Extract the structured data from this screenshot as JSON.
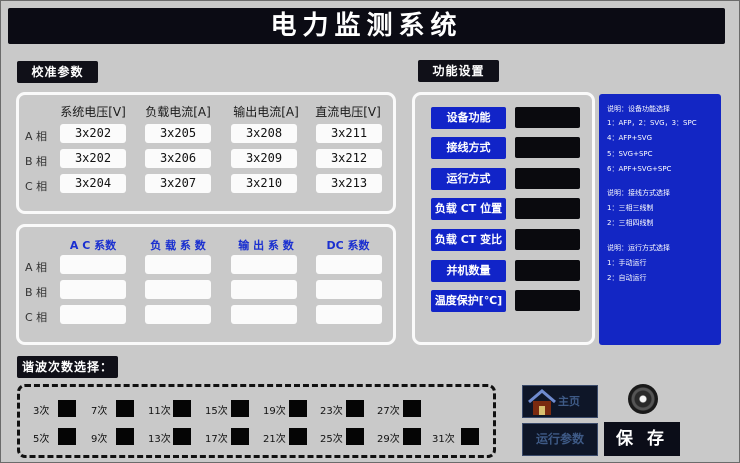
{
  "title": "电力监测系统",
  "sections": {
    "calibration": "校准参数",
    "function": "功能设置",
    "harmonic": "谐波次数选择："
  },
  "calibration_table": {
    "headers": [
      "系统电压[V]",
      "负载电流[A]",
      "输出电流[A]",
      "直流电压[V]"
    ],
    "row_labels": [
      "A 相",
      "B 相",
      "C 相"
    ],
    "rows": [
      [
        "3x202",
        "3x205",
        "3x208",
        "3x211"
      ],
      [
        "3x202",
        "3x206",
        "3x209",
        "3x212"
      ],
      [
        "3x204",
        "3x207",
        "3x210",
        "3x213"
      ]
    ]
  },
  "coefficient_table": {
    "headers": [
      "A C 系数",
      "负 载 系 数",
      "输 出 系 数",
      "DC 系数"
    ],
    "row_labels": [
      "A 相",
      "B 相",
      "C 相"
    ]
  },
  "function_buttons": [
    "设备功能",
    "接线方式",
    "运行方式",
    "负载 CT 位置",
    "负载 CT 变比",
    "并机数量",
    "温度保护[℃]"
  ],
  "info_lines": [
    "说明：设备功能选择",
    "1：AFP，2：SVG，3：SPC",
    "4：AFP+SVG",
    "5：SVG+SPC",
    "6：APF+SVG+SPC",
    "说明：接线方式选择",
    "1：三相三线制",
    "2：三相四线制",
    "说明：运行方式选择",
    "1：手动运行",
    "2：自动运行"
  ],
  "harmonics": {
    "row1": [
      "3次",
      "7次",
      "11次",
      "15次",
      "19次",
      "23次",
      "27次"
    ],
    "row2": [
      "5次",
      "9次",
      "13次",
      "17次",
      "21次",
      "25次",
      "29次",
      "31次"
    ]
  },
  "buttons": {
    "home": "主页",
    "run_params": "运行参数",
    "save": "保 存"
  },
  "colors": {
    "background": "#c9c9c9",
    "accent_blue": "#1124c8",
    "title_bg": "#0b0b14"
  }
}
